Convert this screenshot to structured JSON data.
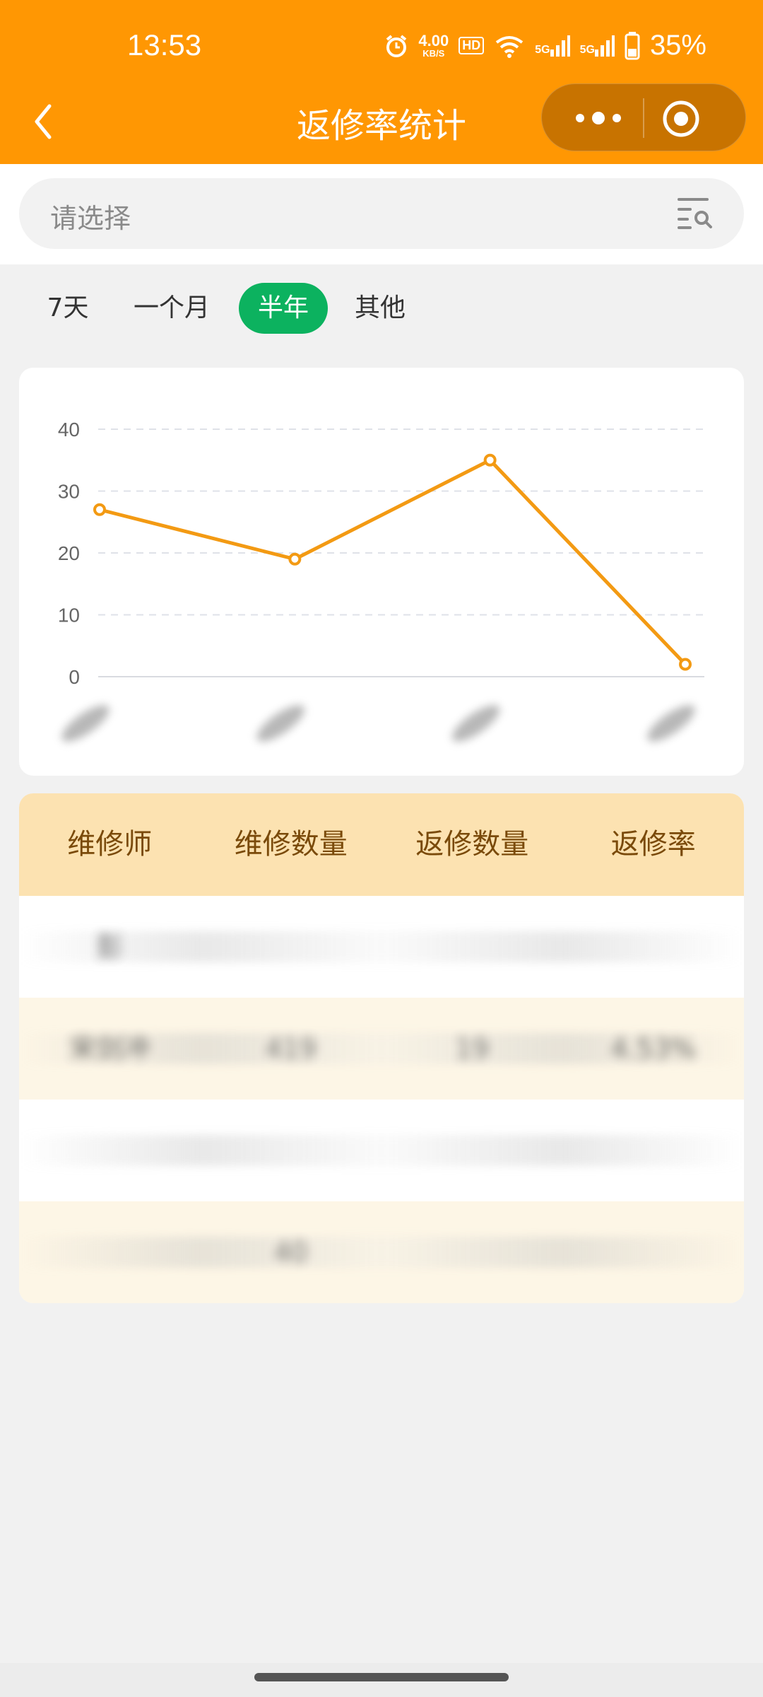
{
  "status_bar": {
    "time": "13:53",
    "net_speed_value": "4.00",
    "net_speed_unit": "KB/S",
    "hd_badge": "HD",
    "signal_1": "5G",
    "signal_2": "5G",
    "battery": "35%"
  },
  "nav": {
    "title": "返修率统计",
    "back_icon": "chevron-left-icon",
    "more_icon": "more-dots-icon",
    "close_icon": "target-circle-icon"
  },
  "search": {
    "placeholder": "请选择",
    "icon": "filter-search-icon"
  },
  "period_tabs": [
    {
      "label": "7天",
      "active": false
    },
    {
      "label": "一个月",
      "active": false
    },
    {
      "label": "半年",
      "active": true
    },
    {
      "label": "其他",
      "active": false
    }
  ],
  "chart_data": {
    "type": "line",
    "y_ticks": [
      "0",
      "10",
      "20",
      "30",
      "40"
    ],
    "ylim": [
      0,
      40
    ],
    "grid": true,
    "series": [
      {
        "color": "#f39a13",
        "values": [
          27,
          19,
          35,
          2
        ]
      }
    ],
    "x_labels_redacted": true
  },
  "table": {
    "headers": [
      "维修师",
      "维修数量",
      "返修数量",
      "返修率"
    ],
    "rows": [
      [
        "彭",
        "",
        "",
        ""
      ],
      [
        "宋剑冲",
        "419",
        "19",
        "4.53%"
      ],
      [
        "",
        "",
        "",
        ""
      ],
      [
        "",
        "40",
        "",
        ""
      ]
    ]
  },
  "colors": {
    "header_bg": "#ff9703",
    "capsule_bg": "#c87300",
    "active_tab": "#0cb25f",
    "line_color": "#f39a13",
    "table_header_bg": "#fce2b1",
    "table_alt_row": "#fdf6e6"
  }
}
